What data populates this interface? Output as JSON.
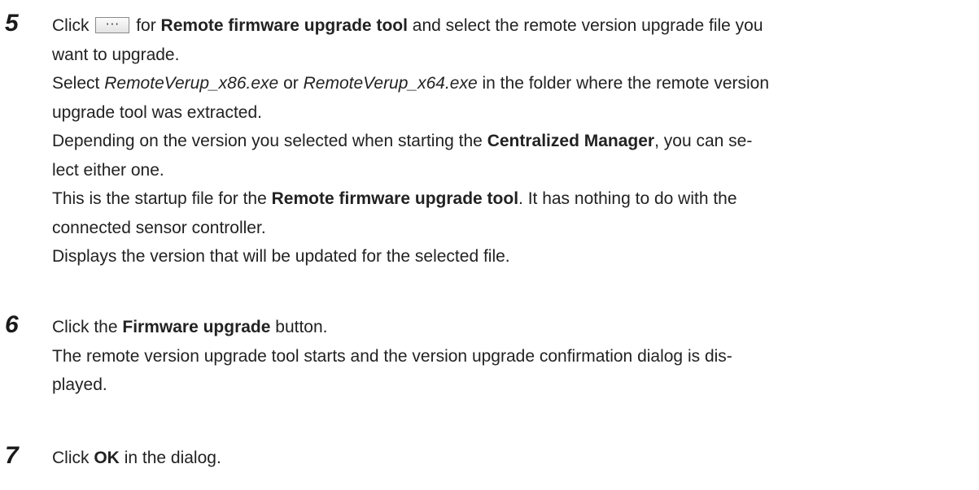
{
  "steps": [
    {
      "number": "5",
      "intro_pre": "Click",
      "intro_icon": "ellipsis-button-icon",
      "intro_for": "for",
      "intro_bold": "Remote firmware upgrade tool",
      "intro_post": "and select the remote version upgrade file you",
      "intro_line2": "want to upgrade.",
      "select_pre": "Select",
      "select_file1": "RemoteVerup_x86.exe",
      "select_or": "or",
      "select_file2": "RemoteVerup_x64.exe",
      "select_post": "in the folder where the remote version",
      "select_line2": "upgrade tool was extracted.",
      "depending_pre": "Depending on the version you selected when starting the",
      "depending_bold": "Centralized Manager",
      "depending_post": ", you can se-",
      "depending_line2": "lect either one.",
      "startup_pre": "This is the startup file for the",
      "startup_bold": "Remote firmware upgrade tool",
      "startup_post": ". It has nothing to do with the",
      "startup_line2": "connected sensor controller.",
      "displays": "Displays the version that will be updated for the selected file."
    },
    {
      "number": "6",
      "click_pre": "Click the",
      "click_bold": "Firmware upgrade",
      "click_post": "button.",
      "result_line1": "The remote version upgrade tool starts and the version upgrade confirmation dialog is dis-",
      "result_line2": "played."
    },
    {
      "number": "7",
      "click_pre": "Click",
      "click_bold": "OK",
      "click_post": "in the dialog."
    }
  ]
}
